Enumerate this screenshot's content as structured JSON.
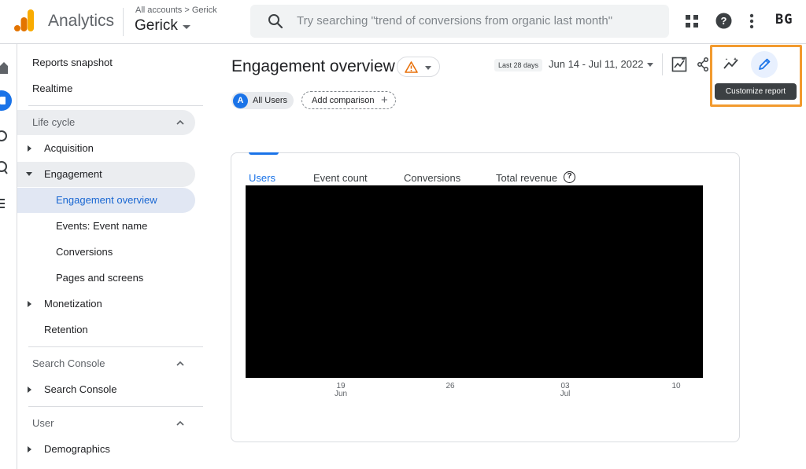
{
  "app": {
    "brand": "Analytics",
    "breadcrumb": "All accounts > Gerick",
    "account_name": "Gerick",
    "avatar_initials": "BG",
    "colors": {
      "brand_orange": "#F9AB00",
      "accent_blue": "#1a73e8",
      "highlight_orange": "#f29a2e"
    }
  },
  "search": {
    "placeholder": "Try searching \"trend of conversions from organic last month\"",
    "icon": "search-icon"
  },
  "topbar_icons": [
    "apps-grid-icon",
    "help-icon",
    "more-vert-icon"
  ],
  "nav": {
    "top_items": [
      {
        "label": "Reports snapshot"
      },
      {
        "label": "Realtime"
      }
    ],
    "sections": [
      {
        "title": "Life cycle",
        "items": [
          {
            "label": "Acquisition",
            "expanded": false
          },
          {
            "label": "Engagement",
            "expanded": true,
            "children": [
              {
                "label": "Engagement overview",
                "active": true
              },
              {
                "label": "Events: Event name"
              },
              {
                "label": "Conversions"
              },
              {
                "label": "Pages and screens"
              }
            ]
          },
          {
            "label": "Monetization",
            "expanded": false
          },
          {
            "label": "Retention"
          }
        ]
      },
      {
        "title": "Search Console",
        "items": [
          {
            "label": "Search Console",
            "expanded": false
          }
        ]
      },
      {
        "title": "User",
        "items": [
          {
            "label": "Demographics",
            "expanded": false
          }
        ]
      }
    ]
  },
  "page": {
    "title": "Engagement overview",
    "date_badge": "Last 28 days",
    "date_range": "Jun 14 - Jul 11, 2022",
    "header_icons": [
      "compare-chart-icon",
      "share-icon",
      "insights-icon",
      "pencil-icon"
    ],
    "tooltip": "Customize report"
  },
  "filters": {
    "segment_letter": "A",
    "segment_label": "All Users",
    "add_comparison": "Add comparison",
    "add_icon": "+"
  },
  "card": {
    "metric_tabs": [
      {
        "label": "Users",
        "selected": true
      },
      {
        "label": "Event count"
      },
      {
        "label": "Conversions"
      },
      {
        "label": "Total revenue"
      }
    ],
    "help_icon": "?",
    "x_ticks": [
      {
        "day": "19",
        "month": "Jun"
      },
      {
        "day": "26",
        "month": ""
      },
      {
        "day": "03",
        "month": "Jul"
      },
      {
        "day": "10",
        "month": ""
      }
    ]
  }
}
